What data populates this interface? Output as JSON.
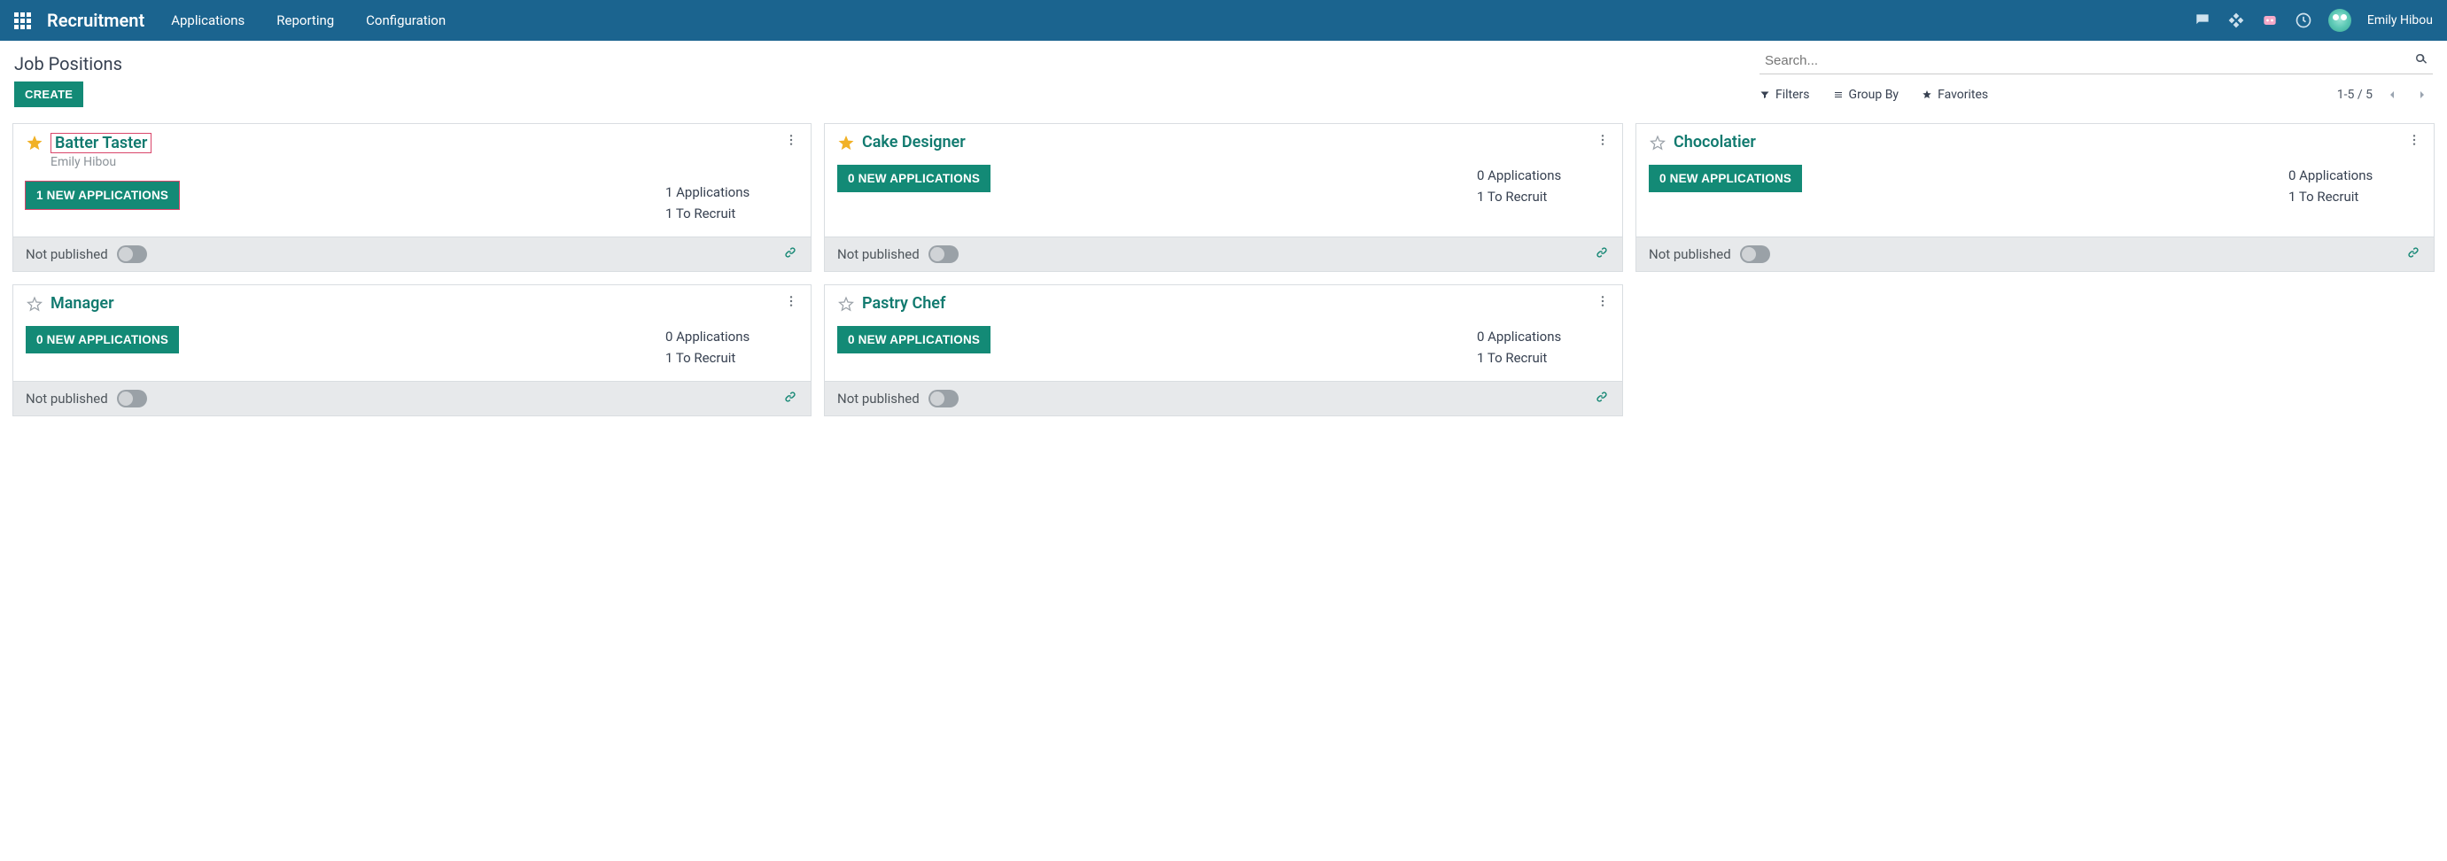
{
  "navbar": {
    "brand": "Recruitment",
    "links": [
      "Applications",
      "Reporting",
      "Configuration"
    ],
    "user": "Emily Hibou"
  },
  "control": {
    "title": "Job Positions",
    "search_placeholder": "Search...",
    "create_label": "CREATE",
    "filters_label": "Filters",
    "groupby_label": "Group By",
    "favorites_label": "Favorites",
    "pager": "1-5 / 5"
  },
  "cards": [
    {
      "title": "Batter Taster",
      "starred": true,
      "subtitle": "Emily Hibou",
      "new_apps_label": "1 NEW APPLICATIONS",
      "stat1": "1 Applications",
      "stat2": "1 To Recruit",
      "footer_label": "Not published",
      "highlight": true
    },
    {
      "title": "Cake Designer",
      "starred": true,
      "subtitle": "",
      "new_apps_label": "0 NEW APPLICATIONS",
      "stat1": "0 Applications",
      "stat2": "1 To Recruit",
      "footer_label": "Not published",
      "highlight": false
    },
    {
      "title": "Chocolatier",
      "starred": false,
      "subtitle": "",
      "new_apps_label": "0 NEW APPLICATIONS",
      "stat1": "0 Applications",
      "stat2": "1 To Recruit",
      "footer_label": "Not published",
      "highlight": false
    },
    {
      "title": "Manager",
      "starred": false,
      "subtitle": "",
      "new_apps_label": "0 NEW APPLICATIONS",
      "stat1": "0 Applications",
      "stat2": "1 To Recruit",
      "footer_label": "Not published",
      "highlight": false
    },
    {
      "title": "Pastry Chef",
      "starred": false,
      "subtitle": "",
      "new_apps_label": "0 NEW APPLICATIONS",
      "stat1": "0 Applications",
      "stat2": "1 To Recruit",
      "footer_label": "Not published",
      "highlight": false
    }
  ]
}
